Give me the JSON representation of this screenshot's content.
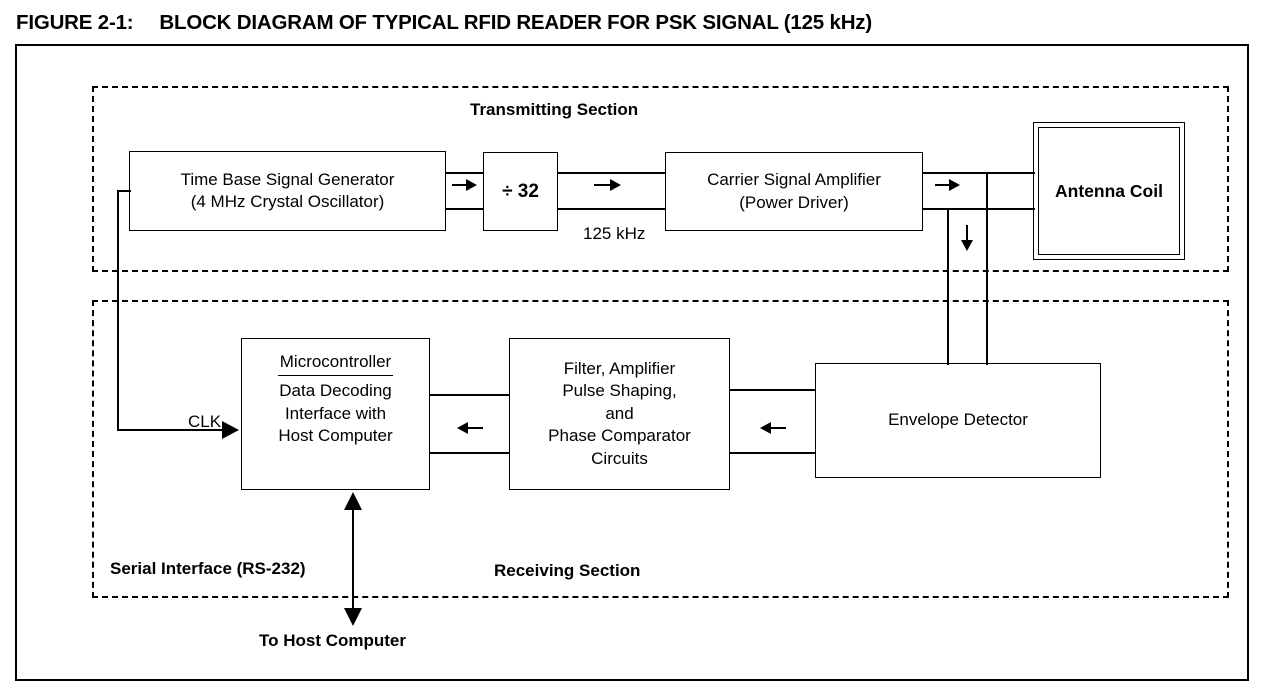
{
  "figure": {
    "label": "FIGURE 2-1:",
    "title": "BLOCK DIAGRAM OF TYPICAL RFID READER FOR PSK SIGNAL (125 kHz)"
  },
  "sections": {
    "transmitting": {
      "title": "Transmitting Section"
    },
    "receiving": {
      "title": "Receiving Section"
    }
  },
  "blocks": {
    "time_base": {
      "line1": "Time Base Signal Generator",
      "line2": "(4 MHz Crystal Oscillator)"
    },
    "divider": {
      "label": "÷ 32"
    },
    "carrier_amp": {
      "line1": "Carrier Signal Amplifier",
      "line2": "(Power Driver)"
    },
    "antenna_coil": {
      "label": "Antenna Coil"
    },
    "microcontroller": {
      "heading": "Microcontroller",
      "line1": "Data Decoding",
      "line2": "Interface with",
      "line3": "Host Computer"
    },
    "filter_block": {
      "line1": "Filter, Amplifier",
      "line2": "Pulse Shaping,",
      "line3": "and",
      "line4": "Phase Comparator",
      "line5": "Circuits"
    },
    "envelope_detector": {
      "label": "Envelope Detector"
    }
  },
  "labels": {
    "frequency": "125 kHz",
    "clk": "CLK",
    "serial_interface": "Serial Interface (RS-232)",
    "to_host": "To Host Computer"
  },
  "icons": {
    "arrow_tb_to_div": "arrow-right-icon",
    "arrow_div_to_amp": "arrow-right-icon",
    "arrow_amp_to_antenna": "arrow-right-icon",
    "arrow_antenna_down": "arrow-down-icon",
    "arrow_env_to_filter": "arrow-left-icon",
    "arrow_filter_to_mcu": "arrow-left-icon",
    "arrow_clk_to_mcu": "arrow-right-icon",
    "arrow_host_up": "arrow-up-icon",
    "arrow_host_down": "arrow-down-icon"
  },
  "colors": {
    "line": "#000000",
    "background": "#ffffff"
  }
}
